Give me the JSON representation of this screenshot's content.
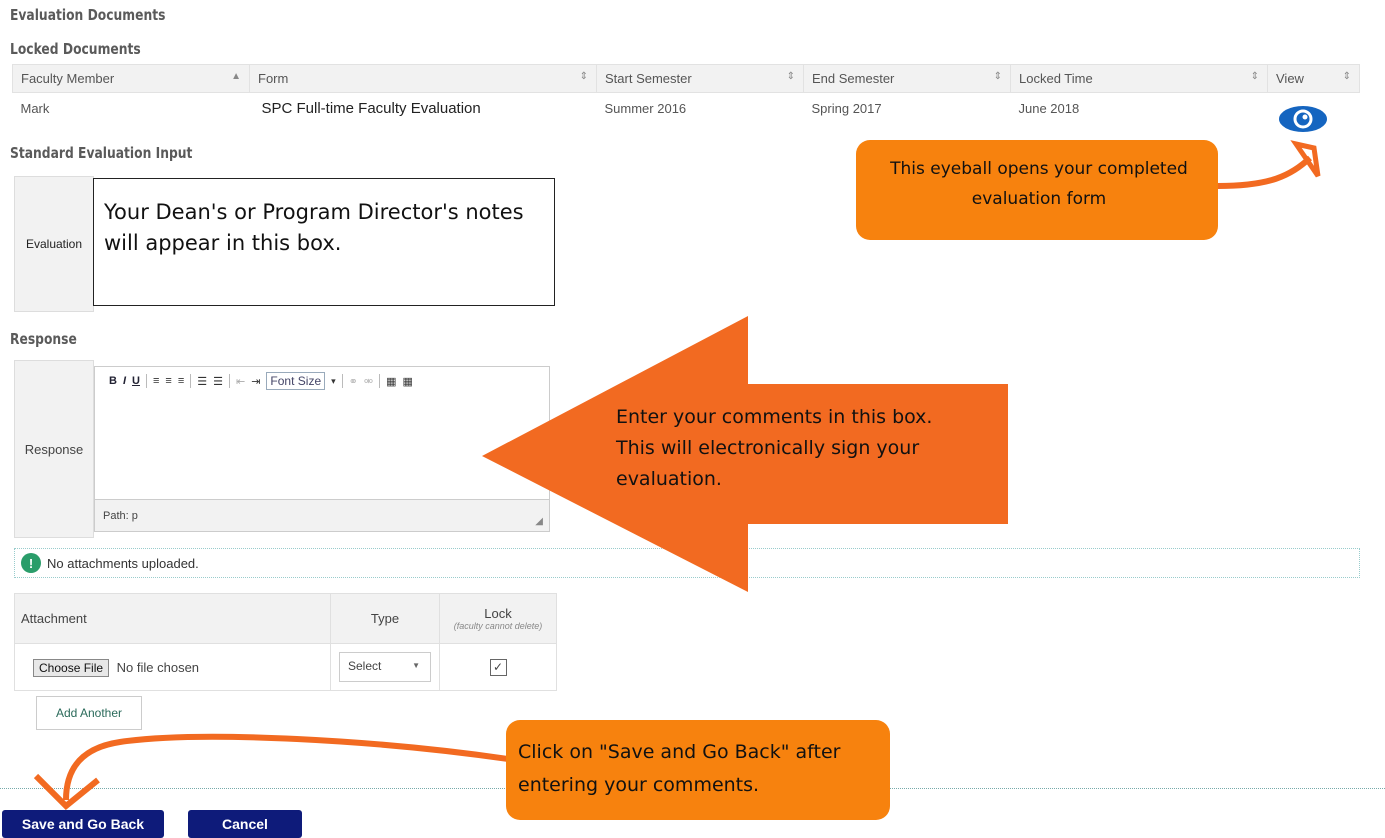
{
  "page": {
    "evaluation_documents_title": "Evaluation Documents",
    "locked_documents_title": "Locked Documents",
    "standard_input_title": "Standard Evaluation Input",
    "response_title": "Response"
  },
  "locked_table": {
    "headers": [
      "Faculty Member",
      "Form",
      "Start Semester",
      "End Semester",
      "Locked Time",
      "View"
    ],
    "row": {
      "faculty": "Mark",
      "form": "SPC Full-time Faculty Evaluation",
      "start": "Summer 2016",
      "end": "Spring 2017",
      "locked": "June 2018"
    }
  },
  "evaluation": {
    "label": "Evaluation",
    "text": "Your Dean's or Program Director's notes will appear in this box."
  },
  "response": {
    "label": "Response",
    "font_size_label": "Font Size",
    "path": "Path: p"
  },
  "attachments": {
    "notice": "No attachments uploaded.",
    "headers": {
      "attachment": "Attachment",
      "type": "Type",
      "lock": "Lock",
      "lock_sub": "(faculty cannot delete)"
    },
    "choose_file": "Choose File",
    "no_file": "No file chosen",
    "select": "Select",
    "add_another": "Add Another"
  },
  "buttons": {
    "save": "Save and Go Back",
    "cancel": "Cancel"
  },
  "callouts": {
    "eyeball": "This eyeball opens your completed evaluation form",
    "comments": "Enter your comments in this box. This will electronically sign your evaluation.",
    "save": "Click on \"Save and Go Back\" after entering your comments."
  },
  "colors": {
    "callout": "#f7820e",
    "arrow": "#f26a21",
    "button": "#0e1b7a",
    "eye": "#1565c0"
  }
}
